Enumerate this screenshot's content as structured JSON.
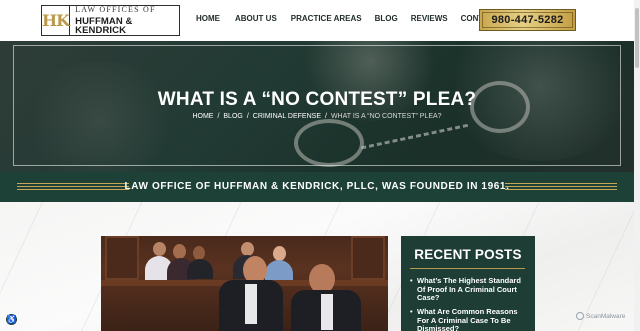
{
  "header": {
    "logo_mark": "HK",
    "logo_line1": "LAW OFFICES OF",
    "logo_line2": "HUFFMAN & KENDRICK",
    "nav": [
      "HOME",
      "ABOUT US",
      "PRACTICE AREAS",
      "BLOG",
      "REVIEWS",
      "CONTACT"
    ],
    "phone": "980-447-5282"
  },
  "hero": {
    "title": "WHAT IS A “NO CONTEST” PLEA?",
    "breadcrumb": [
      "HOME",
      "BLOG",
      "CRIMINAL DEFENSE",
      "WHAT IS A “NO CONTEST” PLEA?"
    ],
    "breadcrumb_separator": "/"
  },
  "banner": {
    "text": "LAW OFFICE OF HUFFMAN & KENDRICK, PLLC, WAS FOUNDED IN 1961.",
    "accent_color": "#c7a656"
  },
  "sidebar": {
    "title": "RECENT POSTS",
    "posts": [
      "What’s The Highest Standard Of Proof In A Criminal Court Case?",
      "What Are Common Reasons For A Criminal Case To Be Dismissed?"
    ]
  },
  "widgets": {
    "accessibility_icon": "accessibility-icon",
    "scan_badge": "ScanMalware"
  },
  "colors": {
    "brand_green": "#1d3d35",
    "gold": "#c7a656"
  }
}
